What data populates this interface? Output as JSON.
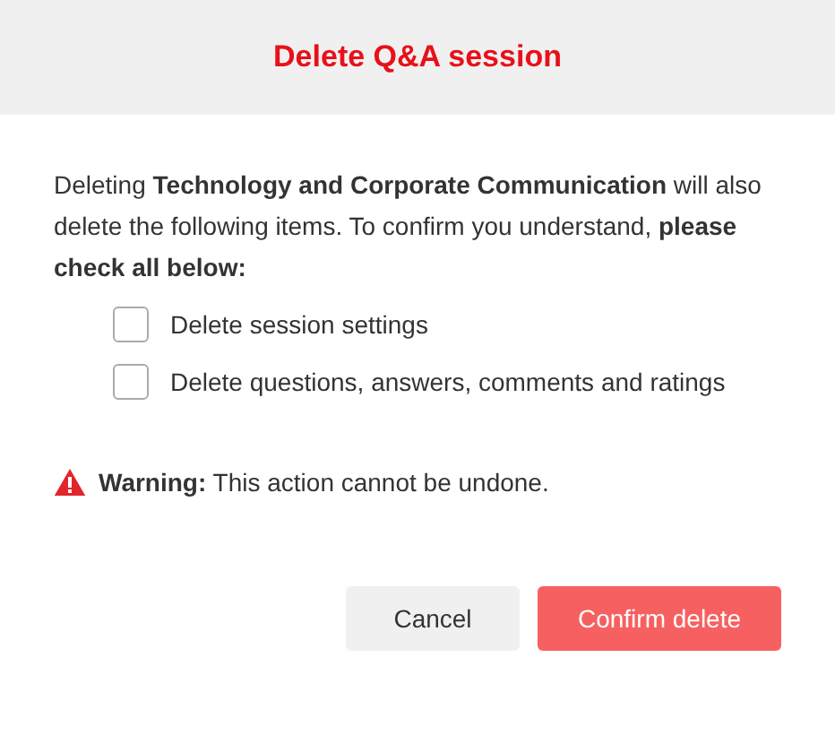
{
  "dialog": {
    "title": "Delete Q&A session",
    "message": "Deleting **Technology and Corporate Communication** will also delete the following items. To confirm you understand, **please check all below:**",
    "checkboxes": [
      {
        "label": "Delete session settings",
        "checked": false
      },
      {
        "label": "Delete questions, answers, comments and ratings",
        "checked": false
      }
    ],
    "warning": "**Warning:** This action cannot be undone.",
    "buttons": [
      {
        "label": "Cancel",
        "kind": "secondary"
      },
      {
        "label": "Confirm delete",
        "kind": "danger"
      }
    ]
  }
}
